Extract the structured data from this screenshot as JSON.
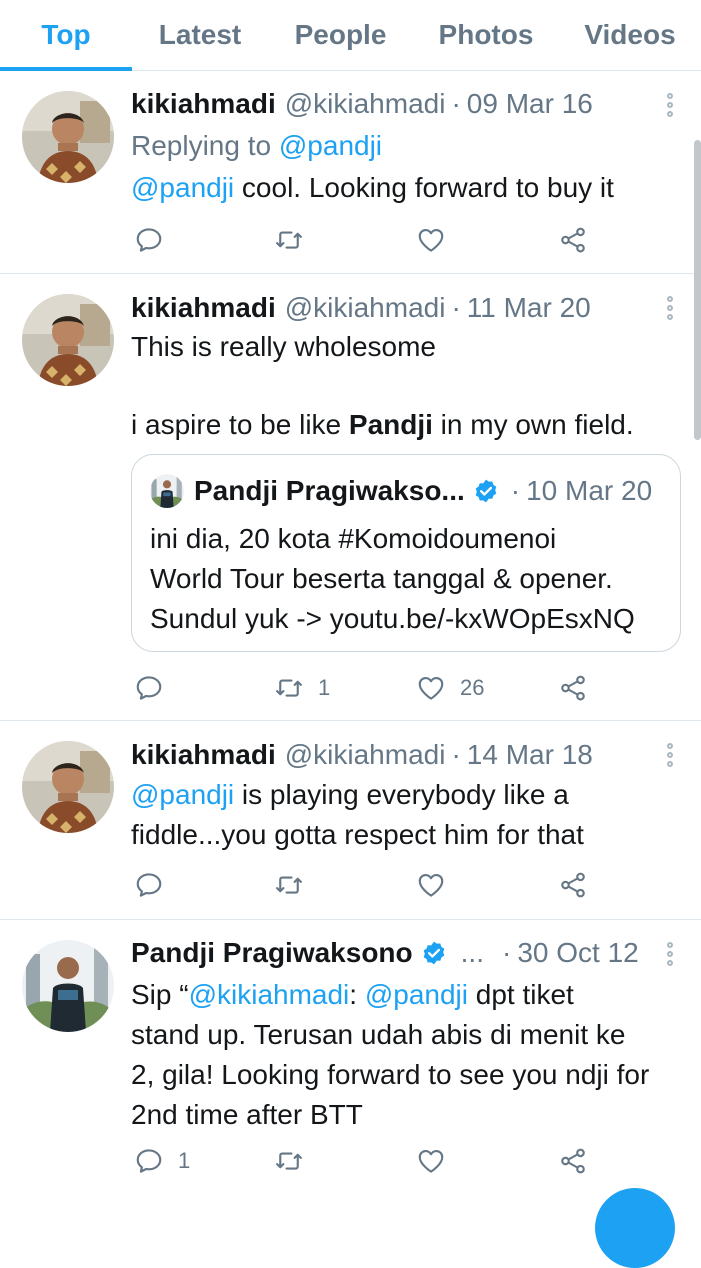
{
  "tabs": [
    {
      "label": "Top"
    },
    {
      "label": "Latest"
    },
    {
      "label": "People"
    },
    {
      "label": "Photos"
    },
    {
      "label": "Videos"
    }
  ],
  "tweets": [
    {
      "name": "kikiahmadi",
      "handle": "@kikiahmadi",
      "dot": "·",
      "date": "09 Mar 16",
      "replying_prefix": "Replying to ",
      "replying_to": "@pandji",
      "mention": "@pandji",
      "text": " cool. Looking forward to buy it"
    },
    {
      "name": "kikiahmadi",
      "handle": "@kikiahmadi",
      "dot": "·",
      "date": "11 Mar 20",
      "line1": "This is really wholesome",
      "line2_pre": "i aspire to be like ",
      "line2_bold": "Pandji",
      "line2_post": " in my own field.",
      "quote": {
        "name": "Pandji Pragiwakso...",
        "dot": "·",
        "date": "10 Mar 20",
        "text": "ini dia, 20 kota #Komoidoumenoi\nWorld Tour beserta tanggal & opener.\nSundul yuk -> youtu.be/-kxWOpEsxNQ"
      },
      "retweets": "1",
      "likes": "26"
    },
    {
      "name": "kikiahmadi",
      "handle": "@kikiahmadi",
      "dot": "·",
      "date": "14 Mar 18",
      "mention": "@pandji",
      "text": " is playing everybody like a\nfiddle...you gotta respect him for that"
    },
    {
      "name": "Pandji Pragiwaksono",
      "ellipsis": "...",
      "dot": "·",
      "date": "30 Oct 12",
      "t_pre": "Sip “",
      "t_mention1": "@kikiahmadi",
      "t_mid": ": ",
      "t_mention2": "@pandji",
      "t_post": " dpt tiket\nstand up. Terusan udah abis di menit ke\n2, gila! Looking forward to see you ndji for\n2nd time after BTT",
      "replies": "1"
    }
  ],
  "colors": {
    "accent": "#1da1f2",
    "muted": "#657786",
    "text": "#14171a",
    "divider": "#e1e8ed"
  },
  "icons": [
    "reply-icon",
    "retweet-icon",
    "like-icon",
    "share-icon",
    "more-icon",
    "verified-icon"
  ]
}
